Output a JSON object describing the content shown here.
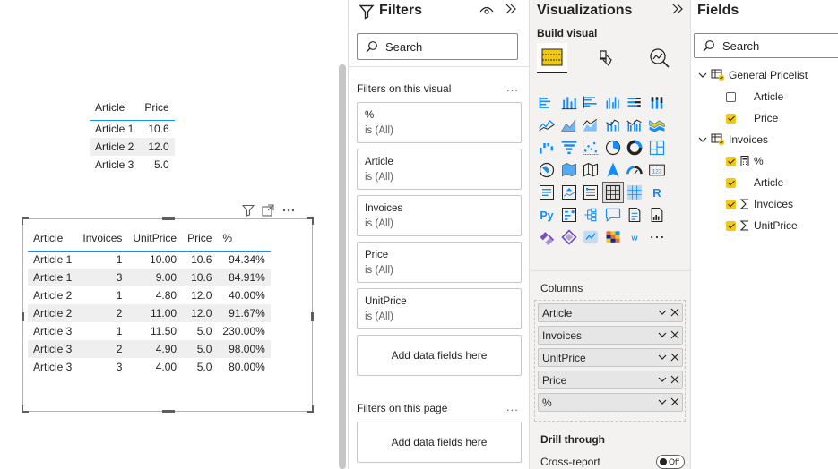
{
  "canvas": {
    "table1": {
      "columns": [
        "Article",
        "Price"
      ],
      "rows": [
        [
          "Article 1",
          "10.6"
        ],
        [
          "Article 2",
          "12.0"
        ],
        [
          "Article 3",
          "5.0"
        ]
      ]
    },
    "table2": {
      "columns": [
        "Article",
        "Invoices",
        "UnitPrice",
        "Price",
        "%"
      ],
      "rows": [
        [
          "Article 1",
          "1",
          "10.00",
          "10.6",
          "94.34%"
        ],
        [
          "Article 1",
          "3",
          "9.00",
          "10.6",
          "84.91%"
        ],
        [
          "Article 2",
          "1",
          "4.80",
          "12.0",
          "40.00%"
        ],
        [
          "Article 2",
          "2",
          "11.00",
          "12.0",
          "91.67%"
        ],
        [
          "Article 3",
          "1",
          "11.50",
          "5.0",
          "230.00%"
        ],
        [
          "Article 3",
          "2",
          "4.90",
          "5.0",
          "98.00%"
        ],
        [
          "Article 3",
          "3",
          "4.00",
          "5.0",
          "80.00%"
        ]
      ]
    }
  },
  "filters": {
    "title": "Filters",
    "search_placeholder": "Search",
    "on_visual_label": "Filters on this visual",
    "more": "...",
    "cards": [
      {
        "field": "%",
        "state": "is (All)"
      },
      {
        "field": "Article",
        "state": "is (All)"
      },
      {
        "field": "Invoices",
        "state": "is (All)"
      },
      {
        "field": "Price",
        "state": "is (All)"
      },
      {
        "field": "UnitPrice",
        "state": "is (All)"
      }
    ],
    "add_fields": "Add data fields here",
    "on_page_label": "Filters on this page",
    "add_fields_page": "Add data fields here"
  },
  "visualizations": {
    "title": "Visualizations",
    "build_visual": "Build visual",
    "columns_label": "Columns",
    "wells": [
      "Article",
      "Invoices",
      "UnitPrice",
      "Price",
      "%"
    ],
    "drill_through": "Drill through",
    "cross_report": "Cross-report",
    "cross_report_state": "Off",
    "r_label": "R",
    "py_label": "Py",
    "more": "..."
  },
  "fields": {
    "title": "Fields",
    "search_placeholder": "Search",
    "tables": [
      {
        "name": "General Pricelist",
        "items": [
          {
            "name": "Article",
            "checked": false,
            "sigma": false
          },
          {
            "name": "Price",
            "checked": true,
            "sigma": false
          }
        ]
      },
      {
        "name": "Invoices",
        "items": [
          {
            "name": "%",
            "checked": true,
            "sigma": false
          },
          {
            "name": "Article",
            "checked": true,
            "sigma": false
          },
          {
            "name": "Invoices",
            "checked": true,
            "sigma": true
          },
          {
            "name": "UnitPrice",
            "checked": true,
            "sigma": true
          }
        ]
      }
    ]
  },
  "colors": {
    "accent": "#118dff",
    "yellow": "#f2c811",
    "pane_bg": "#f3f2f1"
  }
}
